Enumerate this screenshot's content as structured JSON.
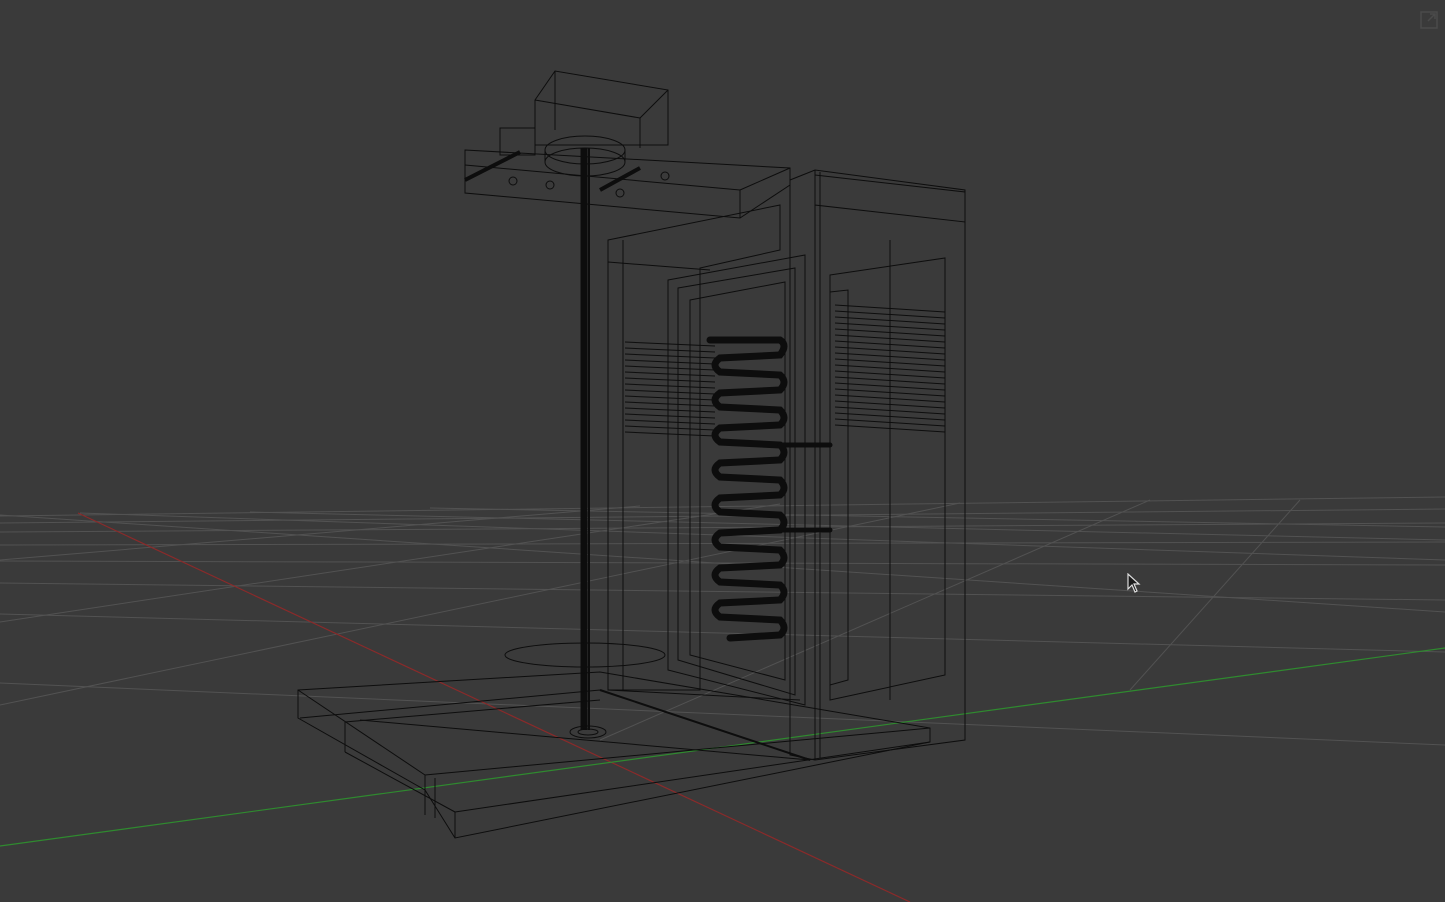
{
  "app": {
    "view": "3d-viewport",
    "display_mode": "wireframe"
  },
  "colors": {
    "background": "#3a3a3a",
    "grid": "#555555",
    "x_axis": "#8a2a2a",
    "y_axis": "#2f8a2f",
    "wire": "#0a0a0a"
  },
  "icons": {
    "maximize": "maximize-icon",
    "cursor": "mouse-pointer-icon"
  }
}
